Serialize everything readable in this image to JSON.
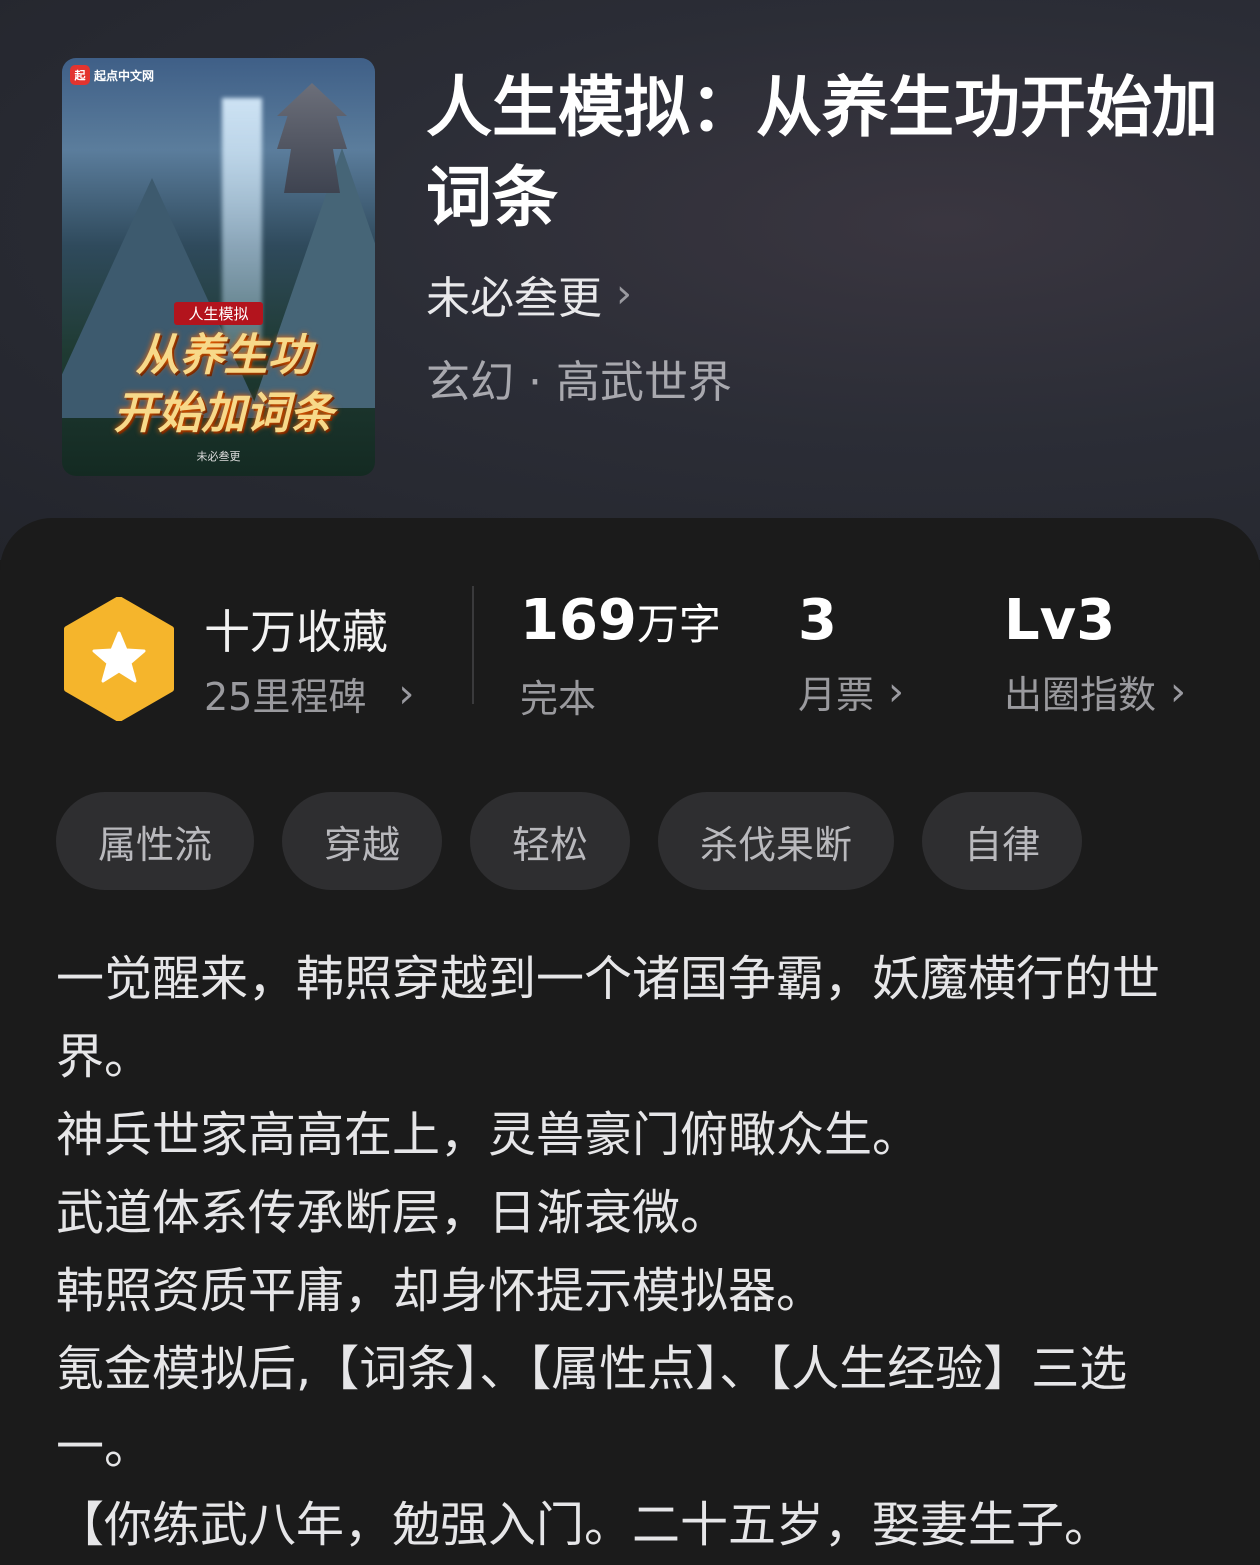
{
  "book": {
    "title": "人生模拟：从养生功开始加词条",
    "author": "未必叁更",
    "genre": "玄幻 · 高武世界",
    "cover": {
      "logo_mark": "起",
      "logo_text": "起点中文网",
      "subtitle": "人生模拟",
      "line1": "从养生功",
      "line2": "开始加词条",
      "author": "未必叁更"
    }
  },
  "favorites": {
    "main": "十万收藏",
    "sub": "25里程碑"
  },
  "stats": {
    "words_value": "169",
    "words_unit": "万字",
    "words_label": "完本",
    "monthly_value": "3",
    "monthly_label": "月票",
    "level_value": "Lv3",
    "level_label": "出圈指数"
  },
  "tags": [
    "属性流",
    "穿越",
    "轻松",
    "杀伐果断",
    "自律"
  ],
  "intro": [
    "一觉醒来，韩照穿越到一个诸国争霸，妖魔横行的世界。",
    "神兵世家高高在上，灵兽豪门俯瞰众生。",
    "武道体系传承断层，日渐衰微。",
    "韩照资质平庸，却身怀提示模拟器。",
    "氪金模拟后,【词条】、【属性点】、【人生经验】三选一。",
    "【你练武八年，勉强入门。二十五岁，娶妻生子。"
  ],
  "colors": {
    "badge": "#f5b52c",
    "panel": "#1b1b1b",
    "tag_bg": "#2e2e30"
  }
}
